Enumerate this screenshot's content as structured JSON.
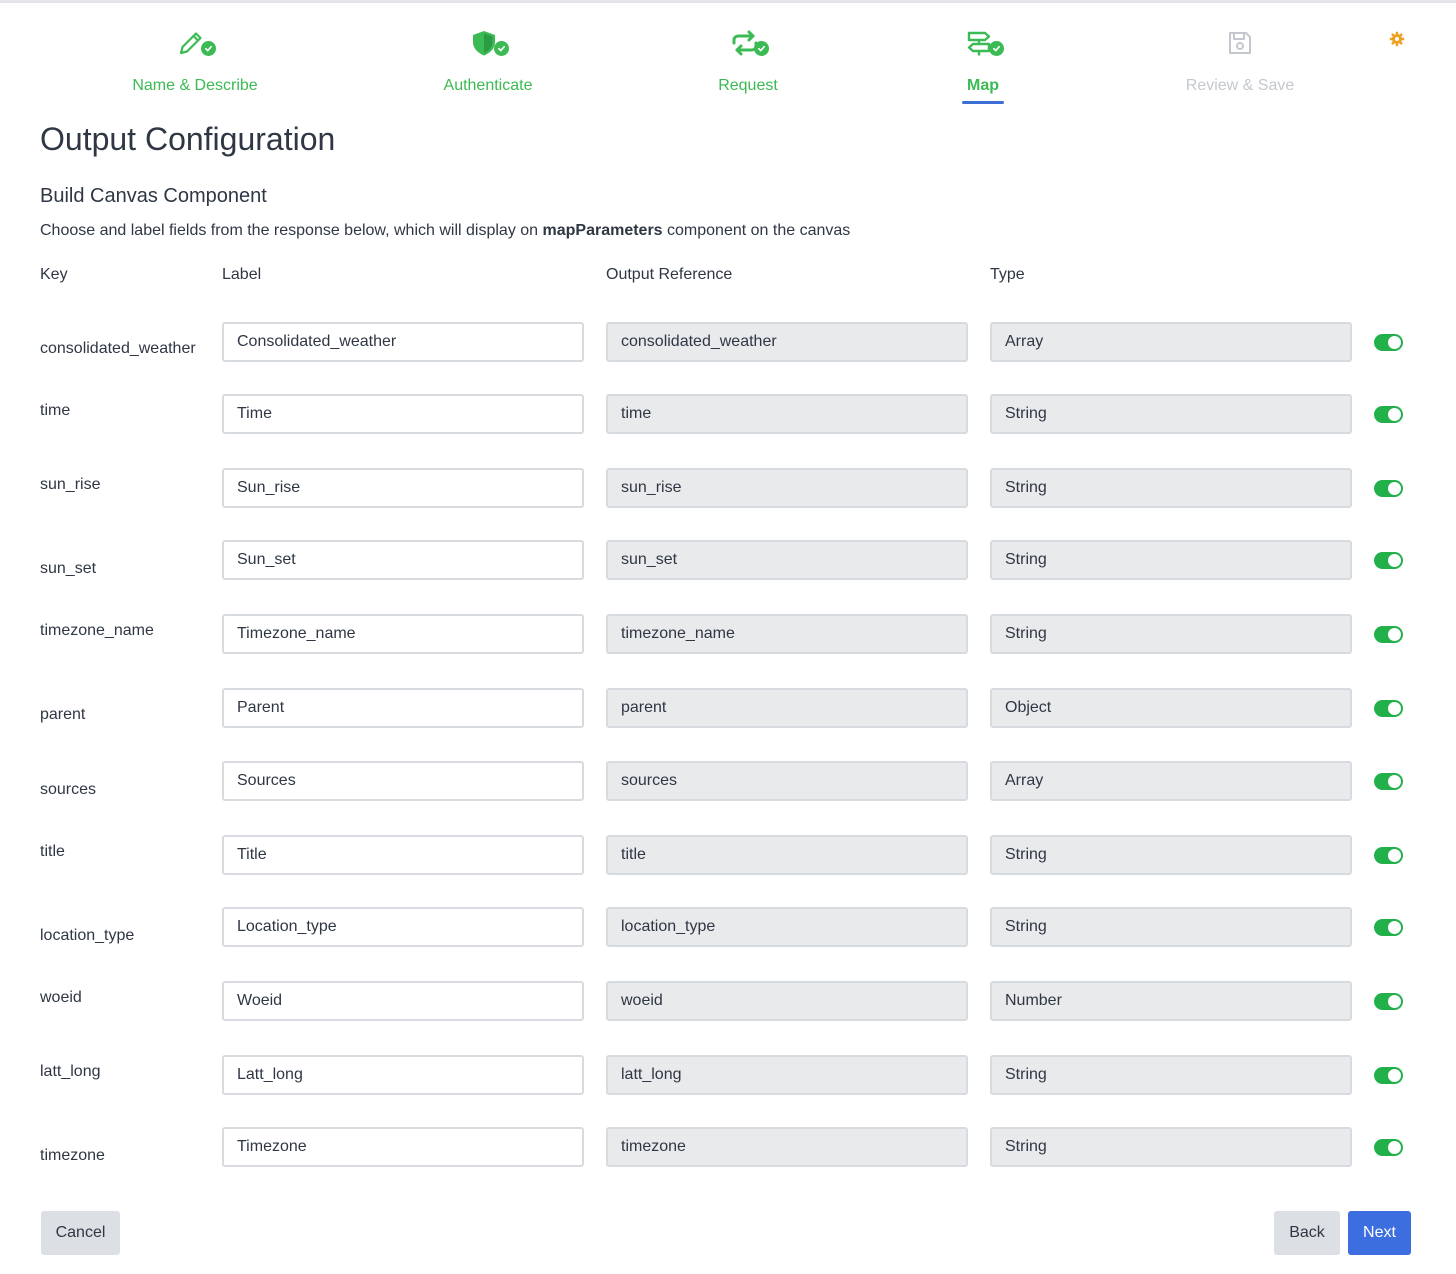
{
  "stepper": {
    "steps": [
      {
        "label": "Name & Describe",
        "icon": "pencil-icon",
        "state": "complete"
      },
      {
        "label": "Authenticate",
        "icon": "shield-icon",
        "state": "complete"
      },
      {
        "label": "Request",
        "icon": "repeat-icon",
        "state": "complete"
      },
      {
        "label": "Map",
        "icon": "signpost-icon",
        "state": "active-complete"
      },
      {
        "label": "Review & Save",
        "icon": "floppy-disk-icon",
        "state": "disabled"
      }
    ],
    "settings_icon": "gear-icon"
  },
  "colors": {
    "success": "#3cba54",
    "primary": "#3d6ee0",
    "toggle_on": "#22b04b",
    "disabled": "#c4c8ce"
  },
  "page": {
    "title": "Output Configuration",
    "section_title": "Build Canvas Component",
    "description_before": "Choose and label fields from the response below, which will display on ",
    "description_bold": "mapParameters",
    "description_after": " component on the canvas"
  },
  "table": {
    "headers": {
      "key": "Key",
      "label": "Label",
      "output_reference": "Output Reference",
      "type": "Type"
    },
    "rows": [
      {
        "key": "consolidated_weather",
        "label": "Consolidated_weather",
        "ref": "consolidated_weather",
        "type": "Array",
        "enabled": true
      },
      {
        "key": "time",
        "label": "Time",
        "ref": "time",
        "type": "String",
        "enabled": true
      },
      {
        "key": "sun_rise",
        "label": "Sun_rise",
        "ref": "sun_rise",
        "type": "String",
        "enabled": true
      },
      {
        "key": "sun_set",
        "label": "Sun_set",
        "ref": "sun_set",
        "type": "String",
        "enabled": true
      },
      {
        "key": "timezone_name",
        "label": "Timezone_name",
        "ref": "timezone_name",
        "type": "String",
        "enabled": true
      },
      {
        "key": "parent",
        "label": "Parent",
        "ref": "parent",
        "type": "Object",
        "enabled": true
      },
      {
        "key": "sources",
        "label": "Sources",
        "ref": "sources",
        "type": "Array",
        "enabled": true
      },
      {
        "key": "title",
        "label": "Title",
        "ref": "title",
        "type": "String",
        "enabled": true
      },
      {
        "key": "location_type",
        "label": "Location_type",
        "ref": "location_type",
        "type": "String",
        "enabled": true
      },
      {
        "key": "woeid",
        "label": "Woeid",
        "ref": "woeid",
        "type": "Number",
        "enabled": true
      },
      {
        "key": "latt_long",
        "label": "Latt_long",
        "ref": "latt_long",
        "type": "String",
        "enabled": true
      },
      {
        "key": "timezone",
        "label": "Timezone",
        "ref": "timezone",
        "type": "String",
        "enabled": true
      }
    ]
  },
  "footer": {
    "cancel_label": "Cancel",
    "back_label": "Back",
    "next_label": "Next"
  }
}
